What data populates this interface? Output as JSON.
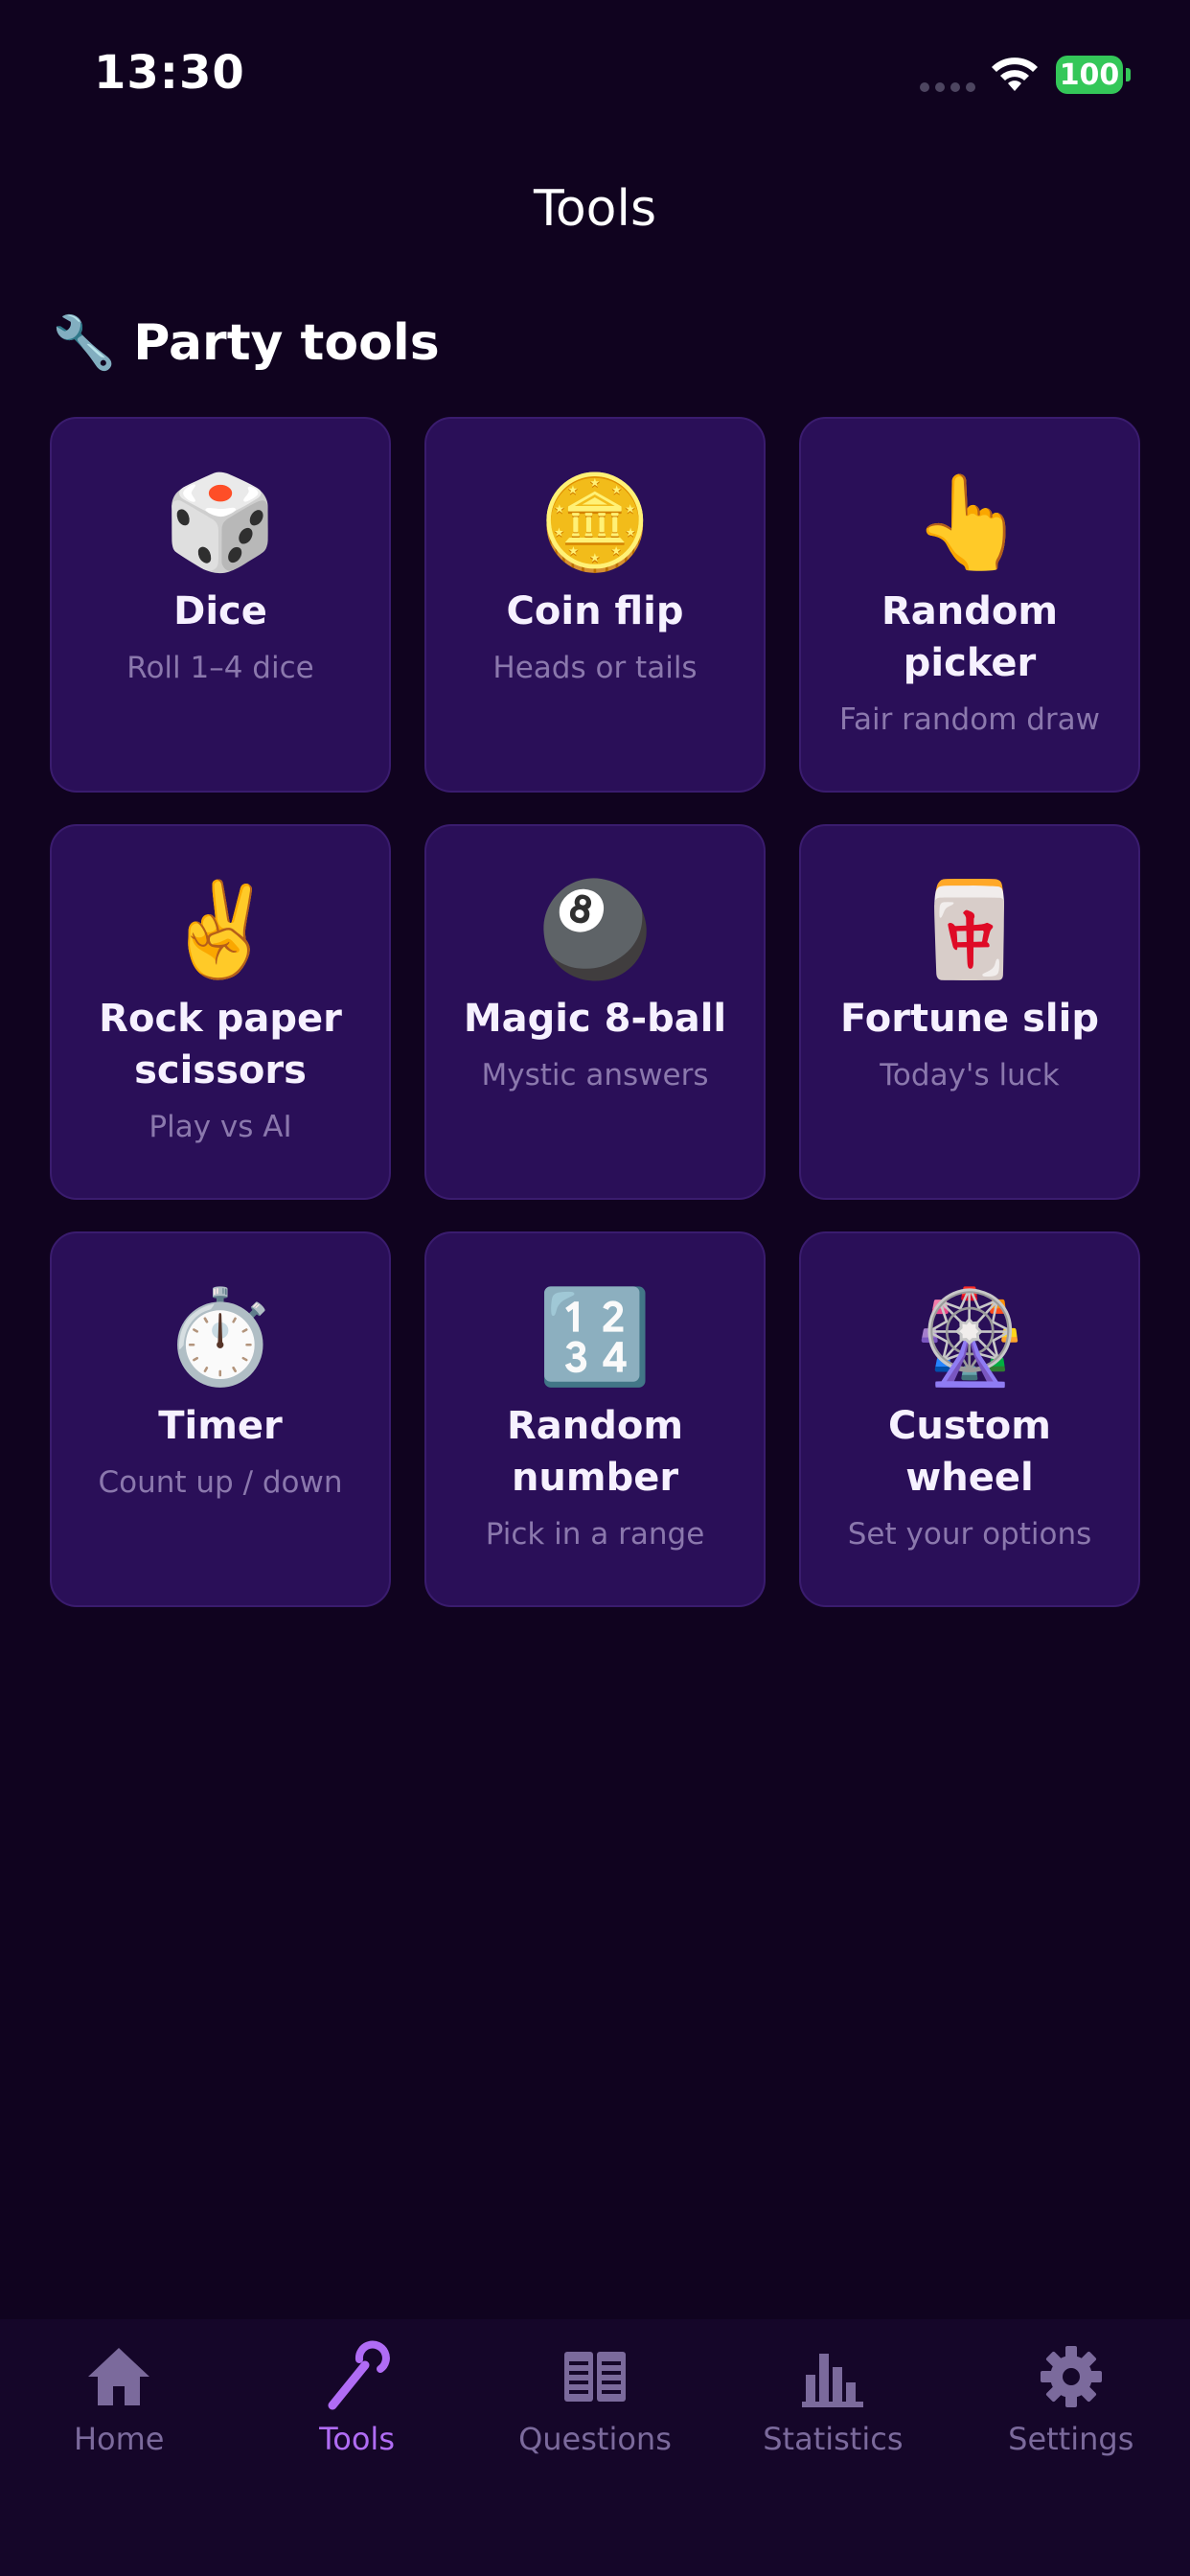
{
  "status_bar": {
    "time": "13:30",
    "battery": "100"
  },
  "page_title": "Tools",
  "section": {
    "icon": "🔧",
    "title": "Party tools"
  },
  "tools": [
    {
      "icon": "🎲",
      "name": "Dice",
      "subtitle": "Roll 1–4 dice"
    },
    {
      "icon": "🪙",
      "name": "Coin flip",
      "subtitle": "Heads or tails"
    },
    {
      "icon": "👆",
      "name": "Random picker",
      "subtitle": "Fair random draw"
    },
    {
      "icon": "✌️",
      "name": "Rock paper scissors",
      "subtitle": "Play vs AI"
    },
    {
      "icon": "🎱",
      "name": "Magic 8-ball",
      "subtitle": "Mystic answers"
    },
    {
      "icon": "🀄",
      "name": "Fortune slip",
      "subtitle": "Today's luck"
    },
    {
      "icon": "⏱️",
      "name": "Timer",
      "subtitle": "Count up / down"
    },
    {
      "icon": "🔢",
      "name": "Random number",
      "subtitle": "Pick in a range"
    },
    {
      "icon": "🎡",
      "name": "Custom wheel",
      "subtitle": "Set your options"
    }
  ],
  "tab_bar": [
    {
      "label": "Home",
      "icon": "home-icon"
    },
    {
      "label": "Tools",
      "icon": "wand-icon",
      "active": true
    },
    {
      "label": "Questions",
      "icon": "book-icon"
    },
    {
      "label": "Statistics",
      "icon": "bar-chart-icon"
    },
    {
      "label": "Settings",
      "icon": "gear-icon"
    }
  ],
  "colors": {
    "background": "#10031f",
    "tile": "#2a0f58",
    "accent": "#b06cf5",
    "battery": "#34c759"
  }
}
